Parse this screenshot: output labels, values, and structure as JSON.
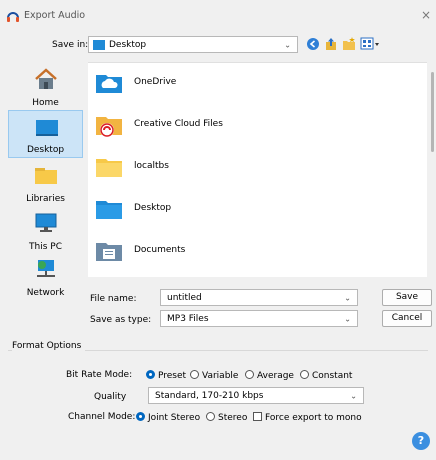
{
  "window": {
    "title": "Export Audio",
    "close": "×"
  },
  "save_in": {
    "label": "Save in:",
    "value": "Desktop"
  },
  "places": [
    {
      "label": "Home"
    },
    {
      "label": "Desktop"
    },
    {
      "label": "Libraries"
    },
    {
      "label": "This PC"
    },
    {
      "label": "Network"
    }
  ],
  "files": [
    {
      "name": "OneDrive",
      "icon": "onedrive-folder-icon"
    },
    {
      "name": "Creative Cloud Files",
      "icon": "creative-cloud-folder-icon"
    },
    {
      "name": "localtbs",
      "icon": "folder-icon"
    },
    {
      "name": "Desktop",
      "icon": "desktop-folder-icon"
    },
    {
      "name": "Documents",
      "icon": "documents-folder-icon"
    }
  ],
  "file_name": {
    "label": "File name:",
    "value": "untitled"
  },
  "save_as_type": {
    "label": "Save as type:",
    "value": "MP3 Files"
  },
  "buttons": {
    "save": "Save",
    "cancel": "Cancel"
  },
  "format_options": {
    "title": "Format Options",
    "bit_rate_mode": {
      "label": "Bit Rate Mode:",
      "options": [
        "Preset",
        "Variable",
        "Average",
        "Constant"
      ],
      "selected": "Preset"
    },
    "quality": {
      "label": "Quality",
      "value": "Standard, 170-210 kbps"
    },
    "channel_mode": {
      "label": "Channel Mode:",
      "options": [
        "Joint Stereo",
        "Stereo"
      ],
      "selected": "Joint Stereo",
      "force_mono": "Force export to mono"
    }
  },
  "help": "?",
  "colors": {
    "accent": "#0067c0",
    "selection": "#cce4f7",
    "folder": "#f7c948",
    "help": "#3b8fe0"
  }
}
